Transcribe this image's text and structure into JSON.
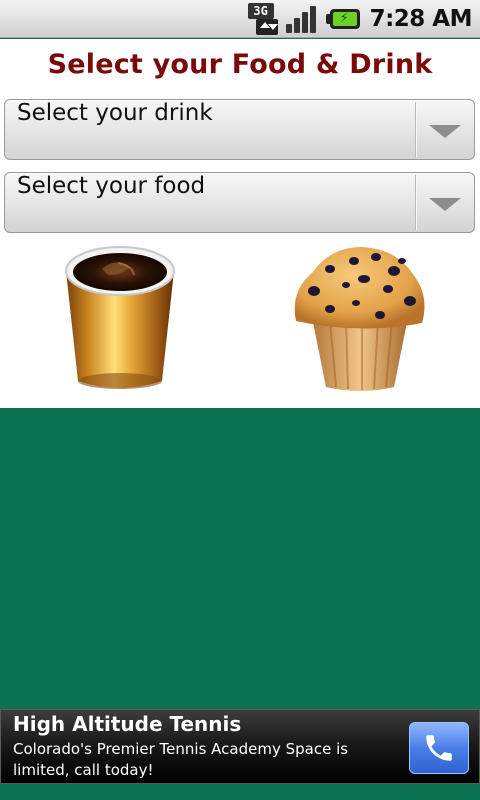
{
  "status_bar": {
    "network_type": "3G",
    "time": "7:28 AM",
    "icons": [
      "3g-data-icon",
      "signal-strength-icon",
      "battery-charging-icon"
    ]
  },
  "page": {
    "title": "Select your Food & Drink"
  },
  "drink_spinner": {
    "selected_label": "Select your drink"
  },
  "food_spinner": {
    "selected_label": "Select your food"
  },
  "images": {
    "drink": "coffee-cup-image",
    "food": "blueberry-muffin-image"
  },
  "ad": {
    "title": "High Altitude Tennis",
    "description": "Colorado's Premier Tennis Academy Space is limited, call today!",
    "call_icon": "phone-icon"
  },
  "colors": {
    "title": "#7a0a0a",
    "background": "#0a7352",
    "call_button": "#4a7fe6"
  }
}
